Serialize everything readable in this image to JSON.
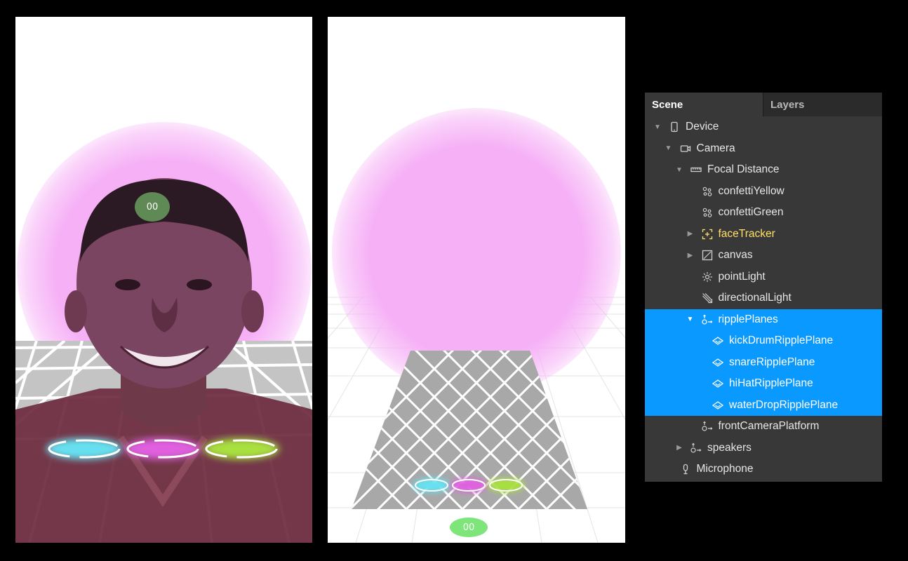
{
  "viewports": {
    "left": {
      "badge_text": "00"
    },
    "right": {
      "badge_text": "00"
    }
  },
  "scene_panel": {
    "tabs": [
      {
        "label": "Scene",
        "active": true
      },
      {
        "label": "Layers",
        "active": false
      }
    ],
    "tree": [
      {
        "label": "Device",
        "icon": "phone-icon",
        "expander": "expanded",
        "level": 0
      },
      {
        "label": "Camera",
        "icon": "camera-icon",
        "expander": "expanded",
        "level": 1
      },
      {
        "label": "Focal Distance",
        "icon": "ruler-icon",
        "expander": "expanded",
        "level": 2
      },
      {
        "label": "confettiYellow",
        "icon": "particles-icon",
        "expander": "none",
        "level": 3
      },
      {
        "label": "confettiGreen",
        "icon": "particles-icon",
        "expander": "none",
        "level": 3
      },
      {
        "label": "faceTracker",
        "icon": "face-tracker-icon",
        "expander": "collapsed",
        "level": 3,
        "color": "#ffe066"
      },
      {
        "label": "canvas",
        "icon": "canvas-icon",
        "expander": "collapsed",
        "level": 3
      },
      {
        "label": "pointLight",
        "icon": "point-light-icon",
        "expander": "none",
        "level": 3
      },
      {
        "label": "directionalLight",
        "icon": "directional-light-icon",
        "expander": "none",
        "level": 3
      },
      {
        "label": "ripplePlanes",
        "icon": "null-object-icon",
        "expander": "expanded",
        "level": 3,
        "selected": true
      },
      {
        "label": "kickDrumRipplePlane",
        "icon": "plane-icon",
        "expander": "none",
        "level": 4,
        "selected": true
      },
      {
        "label": "snareRipplePlane",
        "icon": "plane-icon",
        "expander": "none",
        "level": 4,
        "selected": true
      },
      {
        "label": "hiHatRipplePlane",
        "icon": "plane-icon",
        "expander": "none",
        "level": 4,
        "selected": true
      },
      {
        "label": "waterDropRipplePlane",
        "icon": "plane-icon",
        "expander": "none",
        "level": 4,
        "selected": true
      },
      {
        "label": "frontCameraPlatform",
        "icon": "null-object-icon",
        "expander": "none",
        "level": 3
      },
      {
        "label": "speakers",
        "icon": "null-object-icon",
        "expander": "collapsed",
        "level": 2
      },
      {
        "label": "Microphone",
        "icon": "microphone-icon",
        "expander": "none",
        "level": 1
      }
    ]
  },
  "colors": {
    "selection": "#0a99ff",
    "panel_bg": "#383838",
    "highlight_text": "#ffe066",
    "glow": "#f6b0f6",
    "ripple_cyan": "#66e0f0",
    "ripple_magenta": "#e060e0",
    "ripple_green": "#a8e040"
  }
}
